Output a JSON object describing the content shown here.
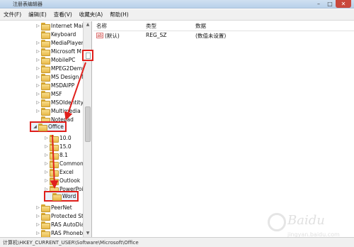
{
  "window": {
    "title": "注册表编辑器",
    "controls": {
      "minimize": "–",
      "maximize": "□",
      "close": "✕"
    }
  },
  "menu": [
    "文件(F)",
    "编辑(E)",
    "查看(V)",
    "收藏夹(A)",
    "帮助(H)"
  ],
  "tree": {
    "items": [
      {
        "label": "Internet Mail",
        "expander": "▷"
      },
      {
        "label": "Keyboard",
        "expander": ""
      },
      {
        "label": "MediaPlayer",
        "expander": "▷"
      },
      {
        "label": "Microsoft M",
        "expander": "▷"
      },
      {
        "label": "MobilePC",
        "expander": "▷"
      },
      {
        "label": "MPEG2Demu",
        "expander": "▷"
      },
      {
        "label": "MS Design To",
        "expander": "▷"
      },
      {
        "label": "MSDAIPP",
        "expander": "▷"
      },
      {
        "label": "MSF",
        "expander": "▷"
      },
      {
        "label": "MSOIdentityC",
        "expander": "▷"
      },
      {
        "label": "Multimedia",
        "expander": "▷"
      },
      {
        "label": "Notepad",
        "expander": ""
      },
      {
        "label": "Office",
        "expander": "◢"
      },
      {
        "label": "10.0",
        "expander": "▷"
      },
      {
        "label": "15.0",
        "expander": "▷"
      },
      {
        "label": "8.1",
        "expander": "▷"
      },
      {
        "label": "Common",
        "expander": "▷"
      },
      {
        "label": "Excel",
        "expander": "▷"
      },
      {
        "label": "Outlook",
        "expander": "▷"
      },
      {
        "label": "PowerPoir",
        "expander": "▷"
      },
      {
        "label": "Word",
        "expander": ""
      },
      {
        "label": "PeerNet",
        "expander": "▷"
      },
      {
        "label": "Protected Sto",
        "expander": "▷"
      },
      {
        "label": "RAS AutoDial",
        "expander": "▷"
      },
      {
        "label": "RAS Phonebo",
        "expander": "▷"
      }
    ]
  },
  "values": {
    "columns": [
      "名称",
      "类型",
      "数据"
    ],
    "rows": [
      {
        "icon": "ab",
        "name": "(默认)",
        "type": "REG_SZ",
        "data": "(数值未设置)"
      }
    ]
  },
  "status": "计算机\\HKEY_CURRENT_USER\\Software\\Microsoft\\Office",
  "watermark": {
    "brand": "Baidu",
    "sub": "jingyan.baidu.com"
  },
  "colors": {
    "annotation": "#e0201c",
    "folder": "#e8b94a"
  }
}
